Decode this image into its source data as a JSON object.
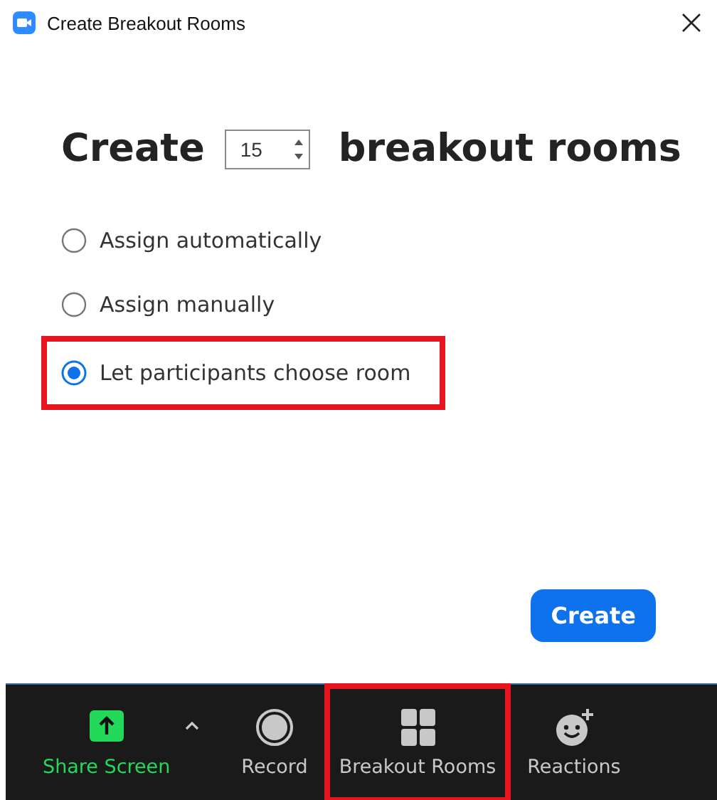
{
  "window": {
    "title": "Create Breakout Rooms"
  },
  "heading": {
    "before": "Create",
    "count": "15",
    "after": "breakout rooms"
  },
  "options": [
    {
      "label": "Assign automatically",
      "selected": false,
      "highlighted": false
    },
    {
      "label": "Assign manually",
      "selected": false,
      "highlighted": false
    },
    {
      "label": "Let participants choose room",
      "selected": true,
      "highlighted": true
    }
  ],
  "create_button": "Create",
  "toolbar": [
    {
      "kind": "share",
      "label": "Share Screen",
      "active": true,
      "highlighted": false
    },
    {
      "kind": "record",
      "label": "Record",
      "active": false,
      "highlighted": false
    },
    {
      "kind": "breakout",
      "label": "Breakout Rooms",
      "active": false,
      "highlighted": true
    },
    {
      "kind": "reactions",
      "label": "Reactions",
      "active": false,
      "highlighted": false
    }
  ]
}
